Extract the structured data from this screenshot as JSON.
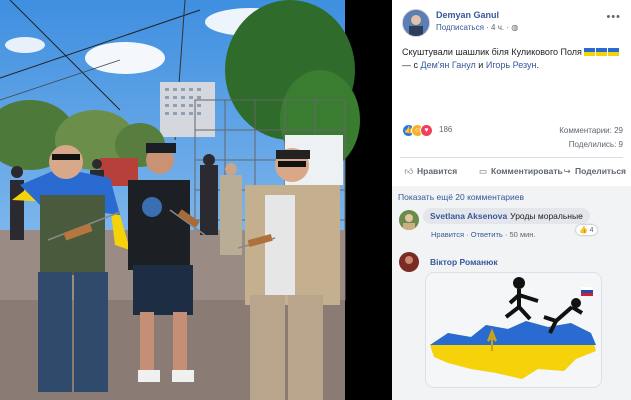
{
  "post": {
    "author": "Demyan Ganul",
    "subscribe_label": "Подписаться",
    "time": "· 4 ч. ·",
    "text_main": "Скуштували шашлик біля Куликового Поля",
    "text_with": "— с",
    "tag1": "Дем'ян Ганул",
    "and_word": "и",
    "tag2": "Игорь Резун",
    "end_dot": "."
  },
  "reactions": {
    "count": "186",
    "comments": "Комментарии: 29",
    "shares": "Поделились: 9"
  },
  "actions": {
    "like": "Нравится",
    "comment": "Комментировать",
    "share": "Поделиться"
  },
  "comments": {
    "show_more": "Показать ещё 20 комментариев",
    "items": [
      {
        "author": "Svetlana Aksenova",
        "text": "Уроды моральные",
        "like": "Нравится",
        "reply": "Ответить",
        "time": "50 мин.",
        "likes": "4"
      },
      {
        "author": "Віктор Романюк"
      }
    ]
  },
  "colors": {
    "link": "#385898",
    "ukraine_blue": "#2a6bd1",
    "ukraine_yellow": "#f5d20a"
  },
  "icons": [
    "globe-icon",
    "more-icon",
    "like-icon",
    "comment-icon",
    "share-icon"
  ]
}
